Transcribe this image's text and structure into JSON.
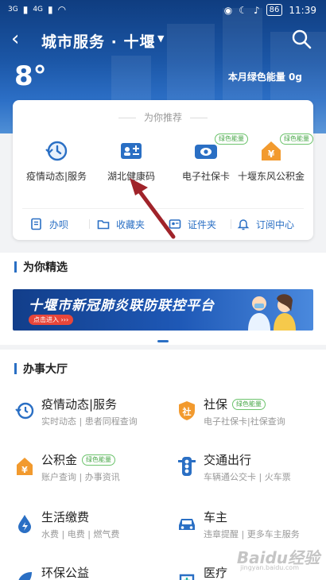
{
  "status_bar": {
    "signal_left": "3G",
    "signal_right": "4G",
    "battery": "86",
    "time": "11:39"
  },
  "header": {
    "title": "城市服务 · 十堰",
    "temperature": "8°",
    "green_energy": "本月绿色能量 0g"
  },
  "recommend": {
    "title": "为你推荐",
    "items": [
      {
        "label": "疫情动态|服务",
        "icon": "clock-refresh-icon",
        "tag": ""
      },
      {
        "label": "湖北健康码",
        "icon": "id-card-icon",
        "tag": ""
      },
      {
        "label": "电子社保卡",
        "icon": "social-card-icon",
        "tag": "绿色能量"
      },
      {
        "label": "十堰东风公积金",
        "icon": "house-fund-icon",
        "tag": "绿色能量"
      }
    ],
    "quick": [
      {
        "label": "办呗",
        "icon": "document-icon"
      },
      {
        "label": "收藏夹",
        "icon": "folder-icon"
      },
      {
        "label": "证件夹",
        "icon": "id-folder-icon"
      },
      {
        "label": "订阅中心",
        "icon": "bell-icon"
      }
    ]
  },
  "featured": {
    "title": "为你精选",
    "banner_text": "十堰市新冠肺炎联防联控平台",
    "banner_button": "点击进入 ›››"
  },
  "hall": {
    "title": "办事大厅",
    "items": [
      {
        "title": "疫情动态|服务",
        "sub": "实时动态 | 患者同程查询",
        "tag": "",
        "icon": "clock-refresh-icon"
      },
      {
        "title": "社保",
        "sub": "电子社保卡|社保查询",
        "tag": "绿色能量",
        "icon": "shield-icon"
      },
      {
        "title": "公积金",
        "sub": "账户查询 | 办事资讯",
        "tag": "绿色能量",
        "icon": "yuan-icon"
      },
      {
        "title": "交通出行",
        "sub": "车辆通公交卡 | 火车票",
        "tag": "",
        "icon": "traffic-light-icon"
      },
      {
        "title": "生活缴费",
        "sub": "水费 | 电费 | 燃气费",
        "tag": "",
        "icon": "water-drop-icon"
      },
      {
        "title": "车主",
        "sub": "违章提醒 | 更多车主服务",
        "tag": "",
        "icon": "car-icon"
      },
      {
        "title": "环保公益",
        "sub": "",
        "tag": "",
        "icon": "leaf-icon"
      },
      {
        "title": "医疗",
        "sub": "",
        "tag": "",
        "icon": "medical-icon"
      }
    ]
  },
  "watermark": {
    "text": "Baidu经验",
    "sub": "jingyan.baidu.com"
  },
  "colors": {
    "primary": "#2a6fc4",
    "header_dark": "#0f3d80",
    "green_tag": "#4aa84a",
    "arrow": "#a0232a"
  }
}
